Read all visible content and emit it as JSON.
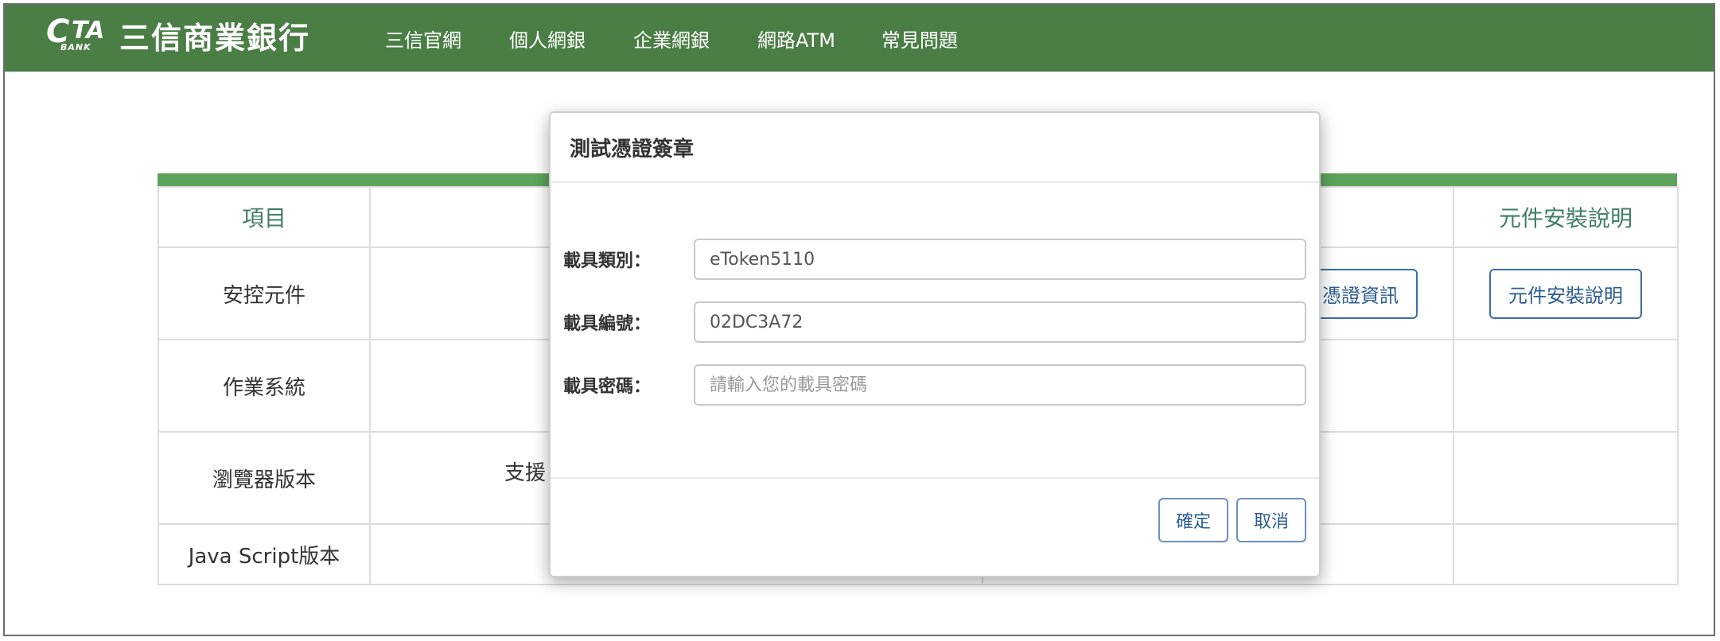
{
  "brand": {
    "logo_mark": "CTA",
    "logo_bank": "BANK",
    "name": "三信商業銀行"
  },
  "nav": {
    "items": [
      "三信官網",
      "個人網銀",
      "企業網銀",
      "網路ATM",
      "常見問題"
    ]
  },
  "table": {
    "header": {
      "col1": "項目",
      "col4": "元件安裝說明"
    },
    "rows": [
      "安控元件",
      "作業系統",
      "瀏覽器版本",
      "Java Script版本"
    ],
    "cert_info_button": "憑證資訊",
    "install_button": "元件安裝說明",
    "support_text": "支援"
  },
  "modal": {
    "title": "測試憑證簽章",
    "fields": [
      {
        "label": "載具類別：",
        "value": "eToken5110",
        "placeholder": ""
      },
      {
        "label": "載具編號：",
        "value": "02DC3A72",
        "placeholder": ""
      },
      {
        "label": "載具密碼：",
        "value": "",
        "placeholder": "請輸入您的載具密碼"
      }
    ],
    "confirm": "確定",
    "cancel": "取消"
  }
}
